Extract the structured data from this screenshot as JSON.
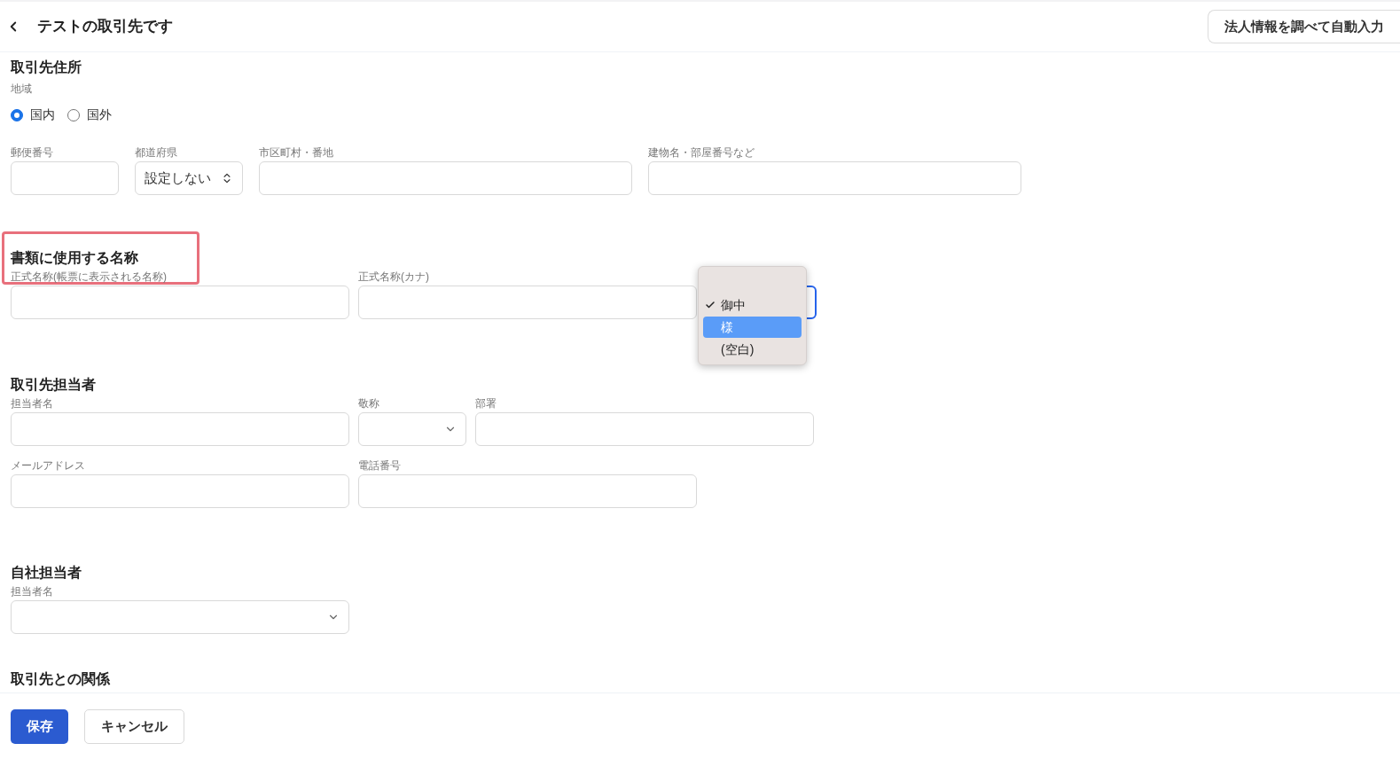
{
  "header": {
    "title": "テストの取引先です",
    "autofill_button": "法人情報を調べて自動入力"
  },
  "address": {
    "heading": "取引先住所",
    "region_label": "地域",
    "region_options": [
      {
        "label": "国内",
        "selected": true
      },
      {
        "label": "国外",
        "selected": false
      }
    ],
    "fields": [
      {
        "label": "郵便番号",
        "kind": "text"
      },
      {
        "label": "都道府県",
        "kind": "stepper",
        "value": "設定しない"
      },
      {
        "label": "市区町村・番地",
        "kind": "text"
      },
      {
        "label": "建物名・部屋番号など",
        "kind": "text"
      }
    ]
  },
  "document_name": {
    "heading": "書類に使用する名称",
    "highlighted": true,
    "fields": [
      {
        "label": "正式名称(帳票に表示される名称)",
        "kind": "text"
      },
      {
        "label": "正式名称(カナ)",
        "kind": "text"
      },
      {
        "kind": "select",
        "focused": true
      }
    ],
    "dropdown": [
      {
        "label": "御中",
        "checked": true,
        "selected": false
      },
      {
        "label": "様",
        "checked": false,
        "selected": true
      },
      {
        "label": "(空白)",
        "checked": false,
        "selected": false
      }
    ]
  },
  "contact": {
    "heading": "取引先担当者",
    "rows": [
      [
        {
          "label": "担当者名",
          "kind": "text"
        },
        {
          "label": "敬称",
          "kind": "select"
        },
        {
          "label": "部署",
          "kind": "text"
        }
      ],
      [
        {
          "label": "メールアドレス",
          "kind": "text"
        },
        {
          "label": "電話番号",
          "kind": "text"
        }
      ]
    ]
  },
  "own_staff": {
    "heading": "自社担当者",
    "fields": [
      {
        "label": "担当者名",
        "kind": "select"
      }
    ]
  },
  "relationship": {
    "heading": "取引先との関係"
  },
  "footer": {
    "save_button": "保存",
    "cancel_button": "キャンセル"
  }
}
